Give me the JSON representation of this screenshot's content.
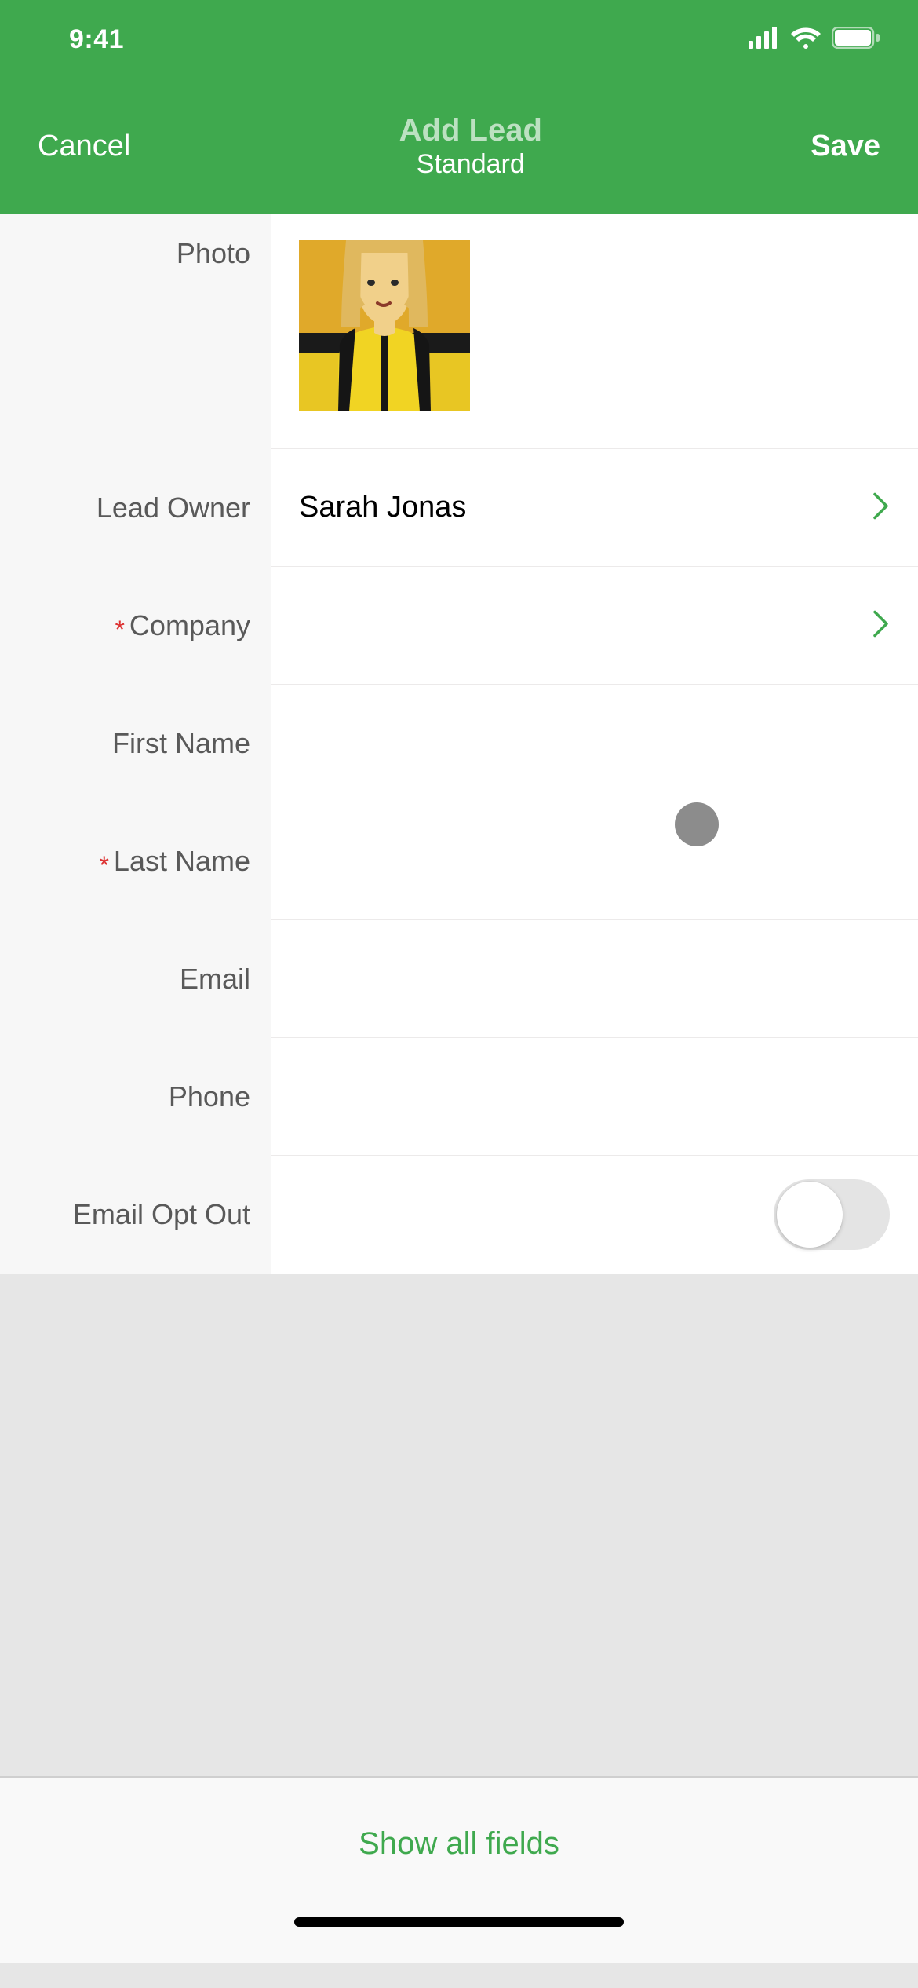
{
  "status": {
    "time": "9:41"
  },
  "nav": {
    "cancel": "Cancel",
    "title": "Add Lead",
    "subtitle": "Standard",
    "save": "Save"
  },
  "fields": {
    "photo_label": "Photo",
    "lead_owner_label": "Lead Owner",
    "lead_owner_value": "Sarah Jonas",
    "company_label": "Company",
    "company_value": "",
    "first_name_label": "First Name",
    "first_name_value": "",
    "last_name_label": "Last Name",
    "last_name_value": "",
    "email_label": "Email",
    "email_value": "",
    "phone_label": "Phone",
    "phone_value": "",
    "email_opt_out_label": "Email Opt Out",
    "email_opt_out_value": false
  },
  "footer": {
    "show_all": "Show all fields"
  },
  "colors": {
    "accent": "#3FA94E",
    "required": "#d33"
  }
}
